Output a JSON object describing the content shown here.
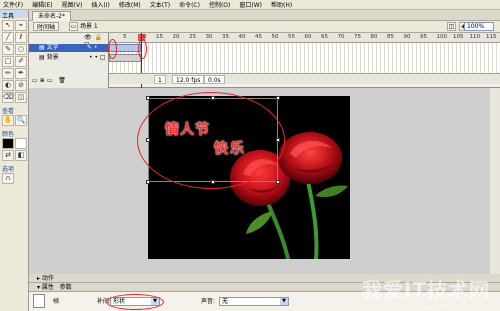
{
  "menu": [
    "文件(F)",
    "编辑(E)",
    "视图(V)",
    "插入(I)",
    "修改(M)",
    "文本(T)",
    "命令(C)",
    "控制(O)",
    "窗口(W)",
    "帮助(H)"
  ],
  "toolbox": {
    "title": "工具",
    "tools": [
      "↖",
      "⌖",
      "╱",
      "ℓ",
      "✎",
      "○",
      "□",
      "✐",
      "✏",
      "✒",
      "◐",
      "⊘",
      "⌫",
      "◫"
    ],
    "view_label": "查看",
    "view_tools": [
      "✋",
      "🔍"
    ],
    "color_label": "颜色",
    "option_label": "选项"
  },
  "doc_tab": "未命名-2*",
  "editbar": {
    "timeline_btn": "时间轴",
    "scene": "场景 1",
    "zoom": "100%"
  },
  "timeline": {
    "layers": [
      {
        "name": "文字",
        "selected": true
      },
      {
        "name": "背景",
        "selected": false
      }
    ],
    "frame_numbers": [
      "5",
      "10",
      "15",
      "20",
      "25",
      "30",
      "35",
      "40",
      "45",
      "50",
      "55",
      "60",
      "65",
      "70",
      "75",
      "80",
      "85",
      "90",
      "95",
      "100",
      "105",
      "110",
      "115"
    ],
    "current_frame": "1",
    "fps": "12.0 fps",
    "time": "0.0s"
  },
  "stage": {
    "text_line1": "情人节",
    "text_line2": "快乐"
  },
  "panels": {
    "actions": "动作",
    "properties_tab": "属性",
    "params_tab": "参数",
    "frame_label": "帧",
    "tween_label": "补间:",
    "tween_value": "形状",
    "sound_label": "声音:",
    "sound_value": "无"
  },
  "watermark": {
    "text": "我爱IT技术网",
    "url": "www.52ij.com"
  },
  "colors": {
    "selection": "#3a64b8",
    "annotation_red": "#e3262a",
    "rose_red": "#d01418"
  }
}
